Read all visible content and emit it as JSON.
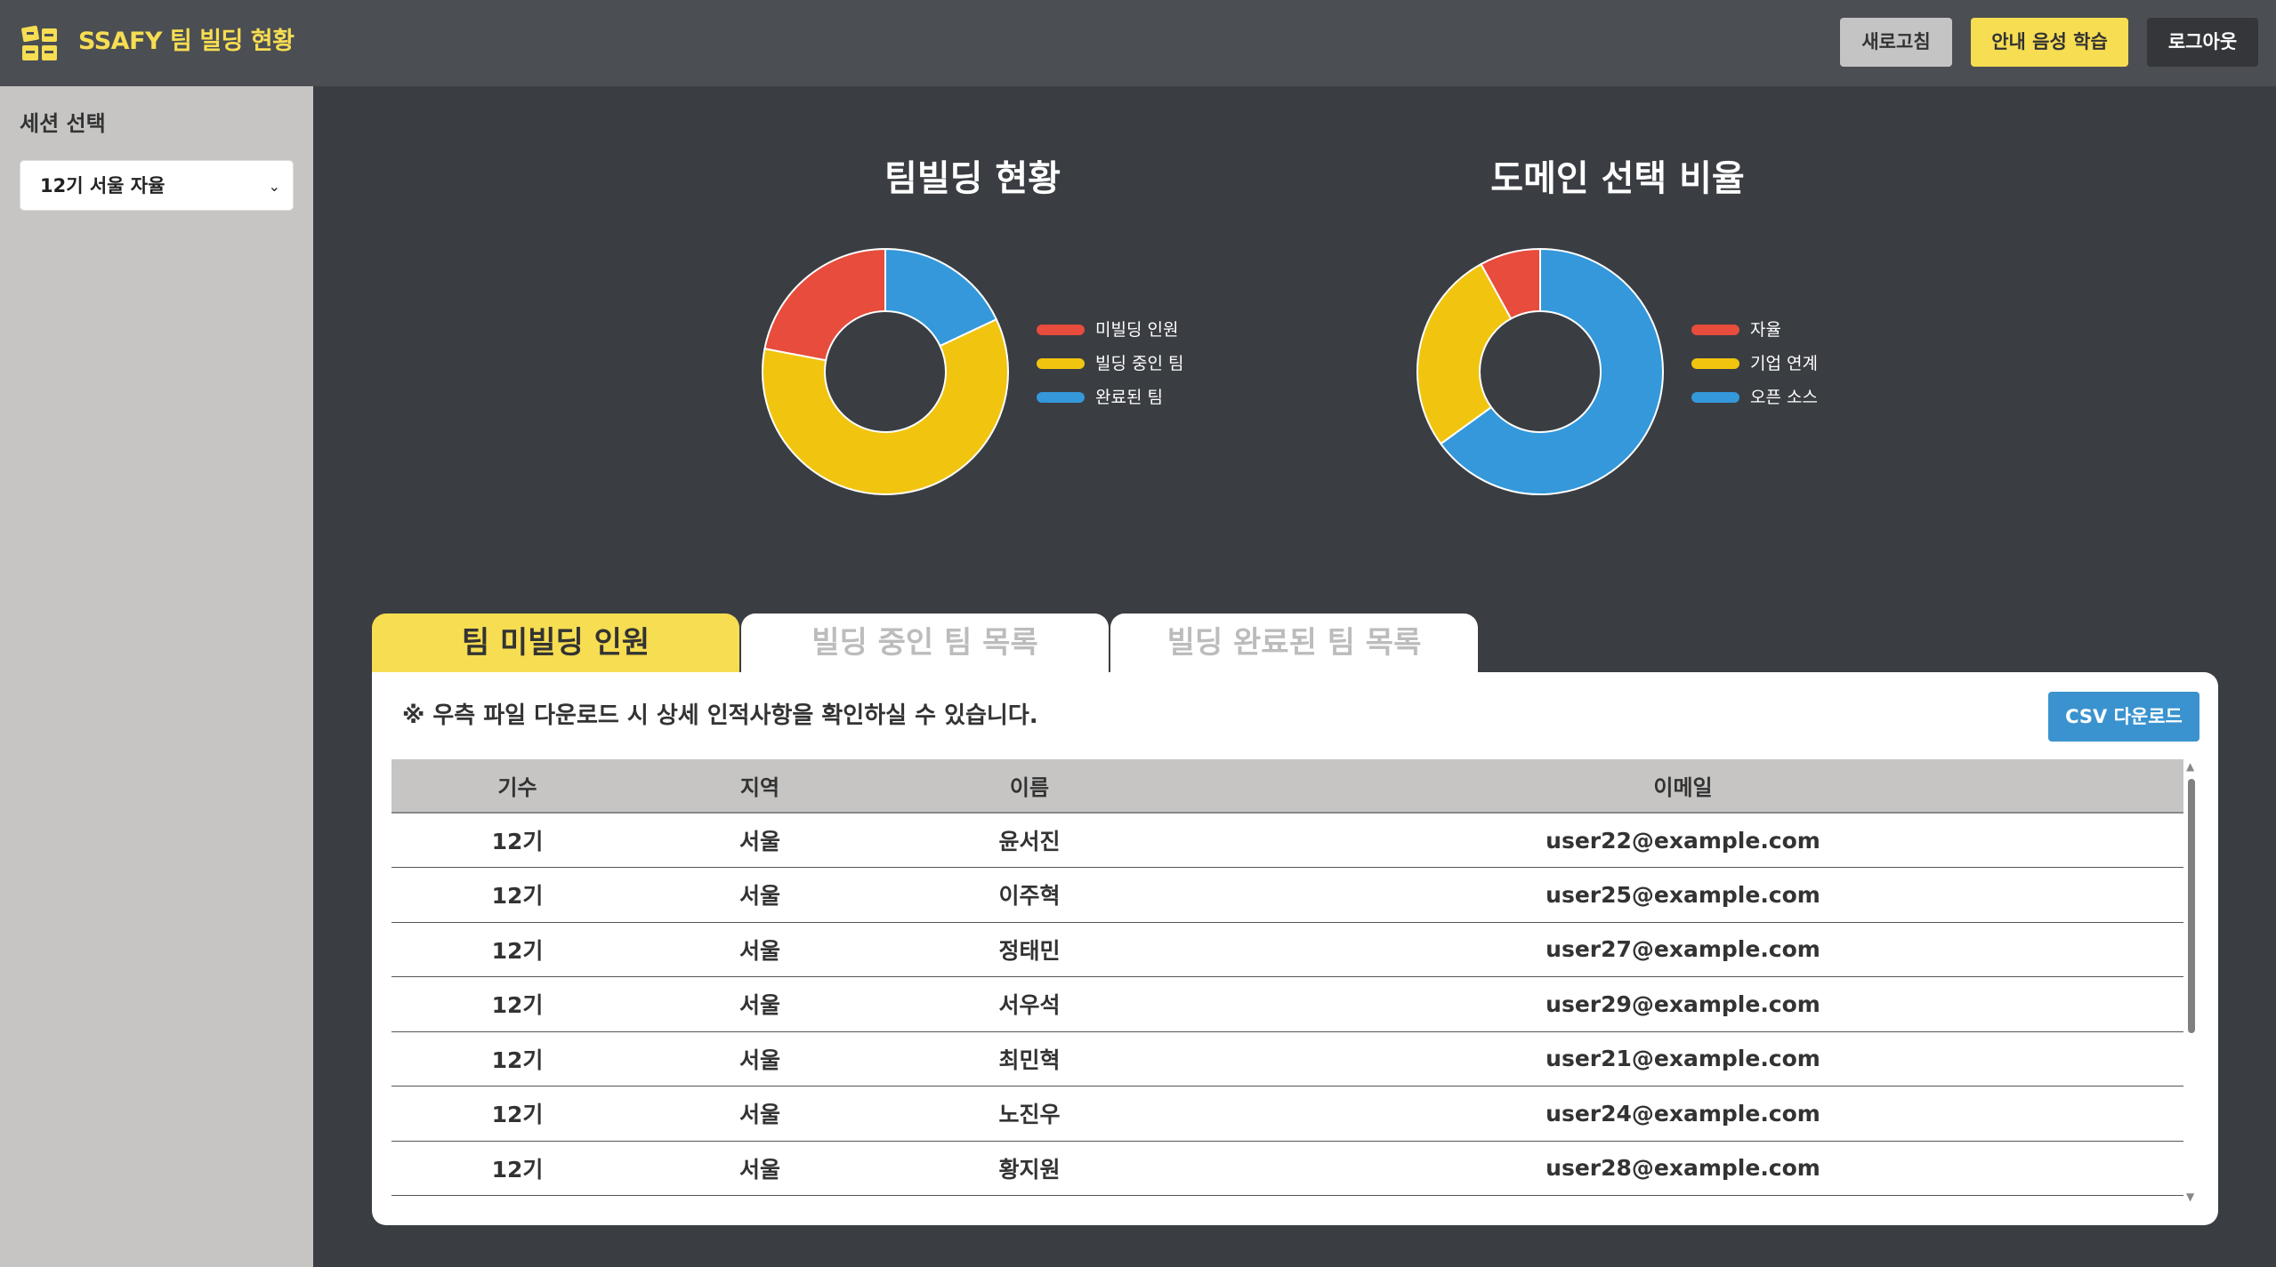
{
  "header": {
    "title": "SSAFY 팀 빌딩 현황",
    "logo_icon": "grid-logo-icon",
    "buttons": {
      "refresh": "새로고침",
      "voice": "안내 음성 학습",
      "logout": "로그아웃"
    }
  },
  "sidebar": {
    "title": "세션 선택",
    "session_value": "12기 서울 자율",
    "chevron_icon": "chevron-down-icon"
  },
  "colors": {
    "red": "#e74c3c",
    "yellow": "#f1c40f",
    "blue": "#3498db",
    "accent": "#f6dd52",
    "csv": "#3a93cf"
  },
  "chart_data": [
    {
      "type": "pie",
      "title": "팀빌딩 현황",
      "categories": [
        "미빌딩 인원",
        "빌딩 중인 팀",
        "완료된 팀"
      ],
      "values": [
        22,
        60,
        18
      ],
      "colors": [
        "#e74c3c",
        "#f1c40f",
        "#3498db"
      ]
    },
    {
      "type": "pie",
      "title": "도메인 선택 비율",
      "categories": [
        "자율",
        "기업 연계",
        "오픈 소스"
      ],
      "values": [
        8,
        27,
        65
      ],
      "colors": [
        "#e74c3c",
        "#f1c40f",
        "#3498db"
      ]
    }
  ],
  "tabs": [
    {
      "label": "팀 미빌딩 인원"
    },
    {
      "label": "빌딩 중인 팀 목록"
    },
    {
      "label": "빌딩 완료된 팀 목록"
    }
  ],
  "panel": {
    "notice": "※ 우측 파일 다운로드 시 상세 인적사항을 확인하실 수 있습니다.",
    "csv_button": "CSV 다운로드",
    "table": {
      "headers": [
        "기수",
        "지역",
        "이름",
        "이메일"
      ],
      "rows": [
        [
          "12기",
          "서울",
          "윤서진",
          "user22@example.com"
        ],
        [
          "12기",
          "서울",
          "이주혁",
          "user25@example.com"
        ],
        [
          "12기",
          "서울",
          "정태민",
          "user27@example.com"
        ],
        [
          "12기",
          "서울",
          "서우석",
          "user29@example.com"
        ],
        [
          "12기",
          "서울",
          "최민혁",
          "user21@example.com"
        ],
        [
          "12기",
          "서울",
          "노진우",
          "user24@example.com"
        ],
        [
          "12기",
          "서울",
          "황지원",
          "user28@example.com"
        ]
      ]
    }
  }
}
